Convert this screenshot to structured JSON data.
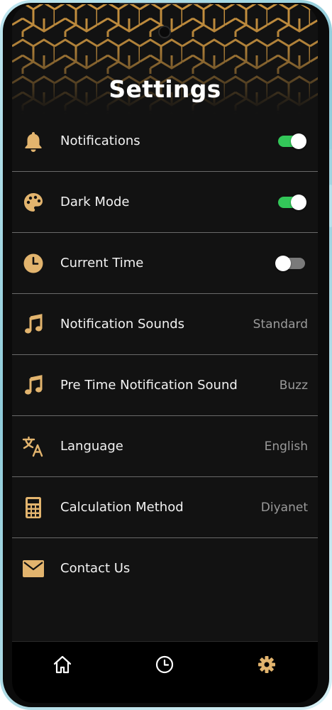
{
  "page": {
    "title": "Settings"
  },
  "colors": {
    "accent": "#e2b46e",
    "toggle_on": "#33c759",
    "toggle_off": "#7a7a7a",
    "background": "#121212"
  },
  "settings": [
    {
      "label": "Notifications",
      "icon": "bell-icon",
      "toggle": "on"
    },
    {
      "label": "Dark Mode",
      "icon": "palette-icon",
      "toggle": "on"
    },
    {
      "label": "Current Time",
      "icon": "clock-icon",
      "toggle": "off"
    },
    {
      "label": "Notification Sounds",
      "icon": "music-note-icon",
      "value": "Standard"
    },
    {
      "label": "Pre Time Notification Sound",
      "icon": "music-note-icon",
      "value": "Buzz"
    },
    {
      "label": "Language",
      "icon": "translate-icon",
      "value": "English"
    },
    {
      "label": "Calculation Method",
      "icon": "calculator-icon",
      "value": "Diyanet"
    },
    {
      "label": "Contact Us",
      "icon": "envelope-icon"
    }
  ],
  "bottom_nav": [
    {
      "icon": "home-icon",
      "active": false
    },
    {
      "icon": "clock-icon",
      "active": false
    },
    {
      "icon": "gear-icon",
      "active": true
    }
  ]
}
